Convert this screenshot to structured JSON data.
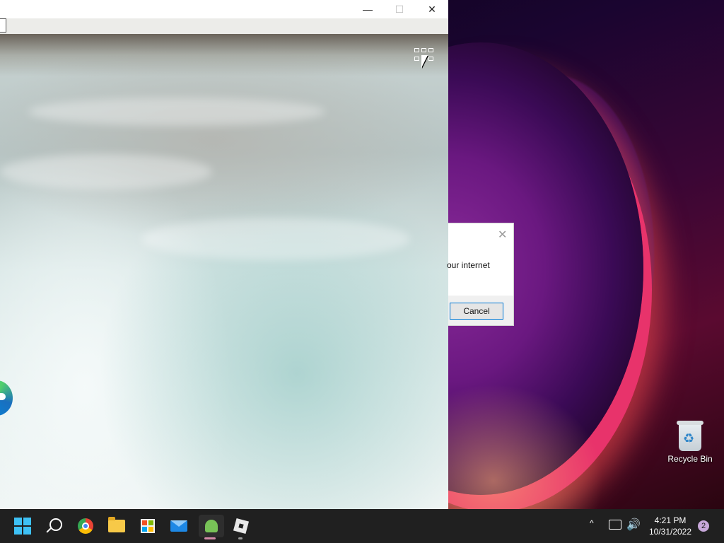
{
  "window": {
    "minimize_icon": "minimize-icon",
    "maximize_icon": "maximize-icon",
    "close_icon": "close-icon",
    "minimize_glyph": "—",
    "maximize_glyph": "☐",
    "close_glyph": "✕"
  },
  "dialog": {
    "text_fragment": "our internet",
    "close_glyph": "✕",
    "cancel_label": "Cancel"
  },
  "desktop": {
    "recycle_bin_label": "Recycle Bin"
  },
  "taskbar": {
    "icons": [
      "windows-start-icon",
      "search-icon",
      "chrome-icon",
      "file-explorer-icon",
      "microsoft-store-icon",
      "mail-icon",
      "android-subsystem-icon",
      "roblox-icon"
    ],
    "time": "4:21 PM",
    "date": "10/31/2022",
    "notification_count": "2",
    "tray_chevron": "^",
    "volume_glyph": "🔊"
  },
  "colors": {
    "taskbar_bg": "#202020",
    "accent": "#0078d4",
    "active_indicator": "#d48aa9"
  }
}
